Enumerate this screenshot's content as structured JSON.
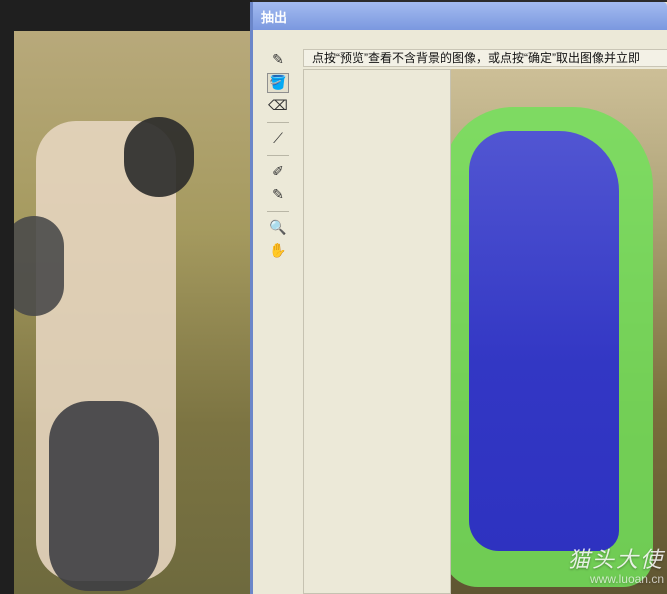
{
  "dialog": {
    "title": "抽出",
    "instruction": "点按“预览”查看不含背景的图像，或点按“确定”取出图像并立即",
    "tools": [
      {
        "name": "edge-highlighter-icon",
        "glyph": "✎",
        "active": false
      },
      {
        "name": "fill-bucket-icon",
        "glyph": "🪣",
        "active": true
      },
      {
        "name": "eraser-icon",
        "glyph": "⌫",
        "active": false
      },
      {
        "name": "eyedropper-icon",
        "glyph": "⟋",
        "active": false
      },
      {
        "name": "cleanup-tool-icon",
        "glyph": "✐",
        "active": false
      },
      {
        "name": "edge-touchup-icon",
        "glyph": "✎",
        "active": false
      },
      {
        "name": "zoom-icon",
        "glyph": "🔍",
        "active": false
      },
      {
        "name": "hand-icon",
        "glyph": "✋",
        "active": false
      }
    ]
  },
  "watermark": {
    "text": "猫头大使",
    "url": "www.luoan.cn"
  },
  "colors": {
    "titlebar_start": "#a3bbf0",
    "titlebar_end": "#7b98df",
    "dialog_bg": "#ece9d8",
    "mask_green": "#72e05a",
    "fill_blue": "#2f2fca"
  }
}
